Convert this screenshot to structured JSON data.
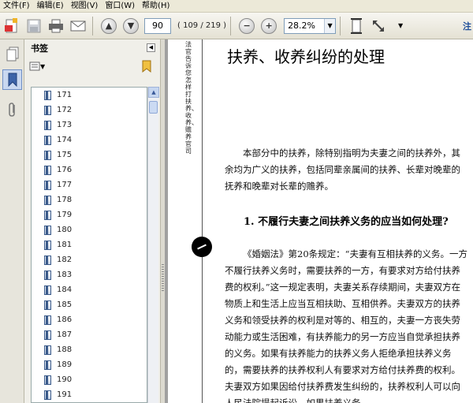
{
  "menu": [
    "文件(F)",
    "编辑(E)",
    "视图(V)",
    "窗口(W)",
    "帮助(H)"
  ],
  "toolbar": {
    "page_current": "90",
    "page_count": "( 109 / 219 )",
    "zoom": "28.2%",
    "annot_label": "注"
  },
  "bookmarks": {
    "title": "书签",
    "items": [
      "171",
      "172",
      "173",
      "174",
      "175",
      "176",
      "177",
      "178",
      "179",
      "180",
      "181",
      "182",
      "183",
      "184",
      "185",
      "186",
      "187",
      "188",
      "189",
      "190",
      "191"
    ]
  },
  "document": {
    "vertical_header": "法官告诉您怎样打扶养、收养、赡养官司",
    "title": "扶养、收养纠纷的处理",
    "intro": "本部分中的扶养，除特别指明为夫妻之间的扶养外，其余均为广义的扶养，包括同辈亲属间的扶养、长辈对晚辈的抚养和晚辈对长辈的赡养。",
    "section_heading": "1. 不履行夫妻之间扶养义务的应当如何处理?",
    "body": "《婚姻法》第20条规定：“夫妻有互相扶养的义务。一方不履行扶养义务时，需要扶养的一方，有要求对方给付扶养费的权利。”这一规定表明，夫妻关系存续期间，夫妻双方在物质上和生活上应当互相扶助、互相供养。夫妻双方的扶养义务和领受扶养的权利是对等的、相互的，夫妻一方丧失劳动能力或生活困难，有扶养能力的另一方应当自觉承担扶养的义务。如果有扶养能力的扶养义务人拒绝承担扶养义务的，需要扶养的扶养权利人有要求对方给付扶养费的权利。夫妻双方如果因给付扶养费发生纠纷的，扶养权利人可以向人民法院提起诉讼。如果扶养义务"
  }
}
